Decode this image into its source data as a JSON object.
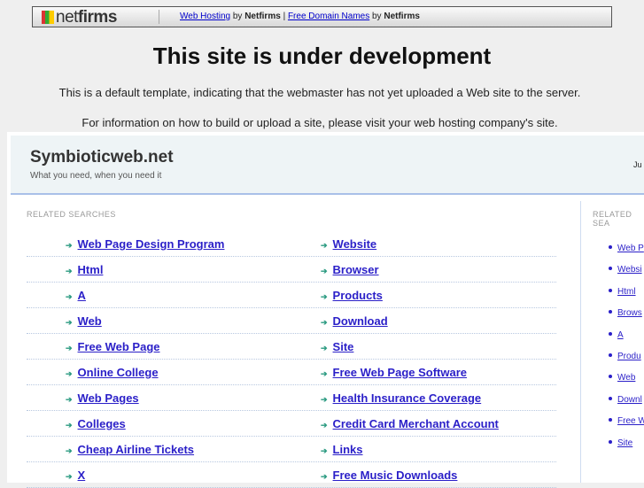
{
  "banner": {
    "logo_text_light": "net",
    "logo_text_bold": "firms",
    "link1": "Web Hosting",
    "by1": "by",
    "brand1": "Netfirms",
    "sep": "|",
    "link2": "Free Domain Names",
    "by2": "by",
    "brand2": "Netfirms"
  },
  "title": "This site is under development",
  "info1": "This is a default template, indicating that the webmaster has not yet uploaded a Web site to the server.",
  "info2": "For information on how to build or upload a site, please visit your web hosting company's site.",
  "site": {
    "name": "Symbioticweb.net",
    "tagline": "What you need, when you need it",
    "right_text": "Ju"
  },
  "related_label": "RELATED SEARCHES",
  "related_label_right": "RELATED SEA",
  "left_col": [
    "Web Page Design Program",
    "Html",
    "A",
    "Web",
    "Free Web Page",
    "Online College",
    "Web Pages",
    "Colleges",
    "Cheap Airline Tickets",
    "X"
  ],
  "right_col": [
    "Website",
    "Browser",
    "Products",
    "Download",
    "Site",
    "Free Web Page Software",
    "Health Insurance Coverage",
    "Credit Card Merchant Account",
    "Links",
    "Free Music Downloads"
  ],
  "sidebar": [
    "Web P",
    "Websi",
    "Html",
    "Brows",
    "A",
    "Produ",
    "Web",
    "Downl",
    "Free W",
    "Site"
  ]
}
